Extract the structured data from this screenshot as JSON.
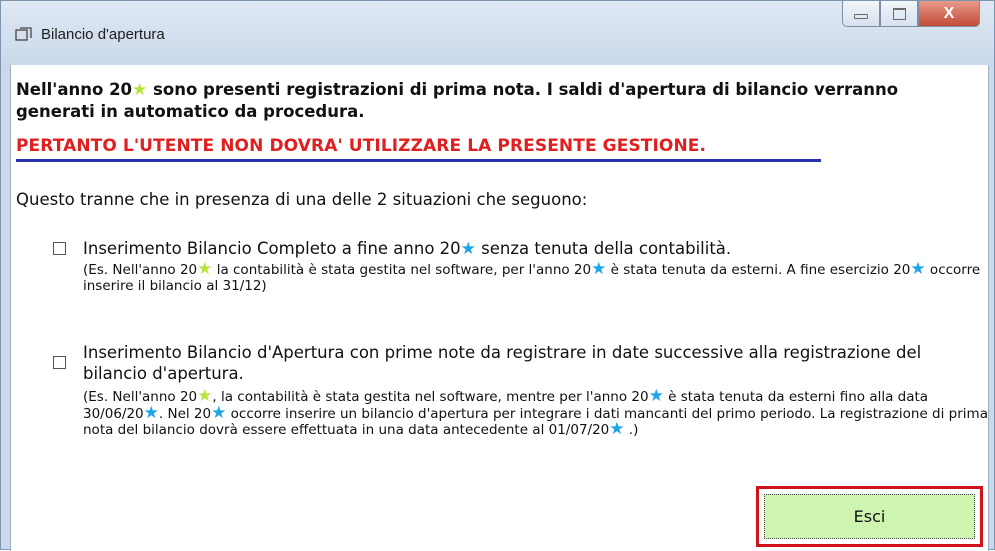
{
  "window": {
    "title": "Bilancio d'apertura",
    "controls": {
      "minimize": "—",
      "maximize": "□",
      "close": "X"
    }
  },
  "message": {
    "intro_part1": "Nell'anno 20",
    "intro_part2": " sono presenti registrazioni di prima nota. I saldi d'apertura di bilancio verranno generati in automatico da procedura.",
    "warning": "PERTANTO L'UTENTE NON DOVRA' UTILIZZARE LA PRESENTE GESTIONE.",
    "situations_intro": "Questo tranne che in presenza di una delle 2 situazioni che seguono:"
  },
  "options": [
    {
      "checked": false,
      "title_part1": "Inserimento Bilancio Completo a fine anno 20",
      "title_part2": " senza tenuta della contabilità.",
      "note_part1": "(Es. Nell'anno 20",
      "note_part2": " la contabilità è stata gestita nel software, per l'anno 20",
      "note_part3": " è stata tenuta da esterni. A fine esercizio 20",
      "note_part4": " occorre inserire il bilancio al 31/12)"
    },
    {
      "checked": false,
      "title": "Inserimento Bilancio d'Apertura con prime note da registrare in date successive alla registrazione del bilancio d'apertura.",
      "note_part1": "(Es. Nell'anno 20",
      "note_part2": ", la contabilità è stata gestita nel software, mentre per l'anno 20",
      "note_part3": " è stata tenuta da esterni fino alla data 30/06/20",
      "note_part4": ". Nel 20",
      "note_part5": " occorre inserire un bilancio d'apertura per integrare i dati mancanti del primo periodo. La registrazione di prima nota del bilancio dovrà essere effettuata in una data antecedente al 01/07/20",
      "note_part6": " .)"
    }
  ],
  "buttons": {
    "exit_label": "Esci"
  },
  "icons": {
    "star_yellow": "star-icon-yellow",
    "star_blue": "star-icon-blue",
    "star_glyph": "★"
  },
  "colors": {
    "warning_text": "#e02020",
    "warning_underline": "#2b2fb0",
    "star_yellow": "#b6e53b",
    "star_blue": "#1ea4e8",
    "button_bg": "#cef5b0",
    "highlight_border": "#d0121b"
  }
}
